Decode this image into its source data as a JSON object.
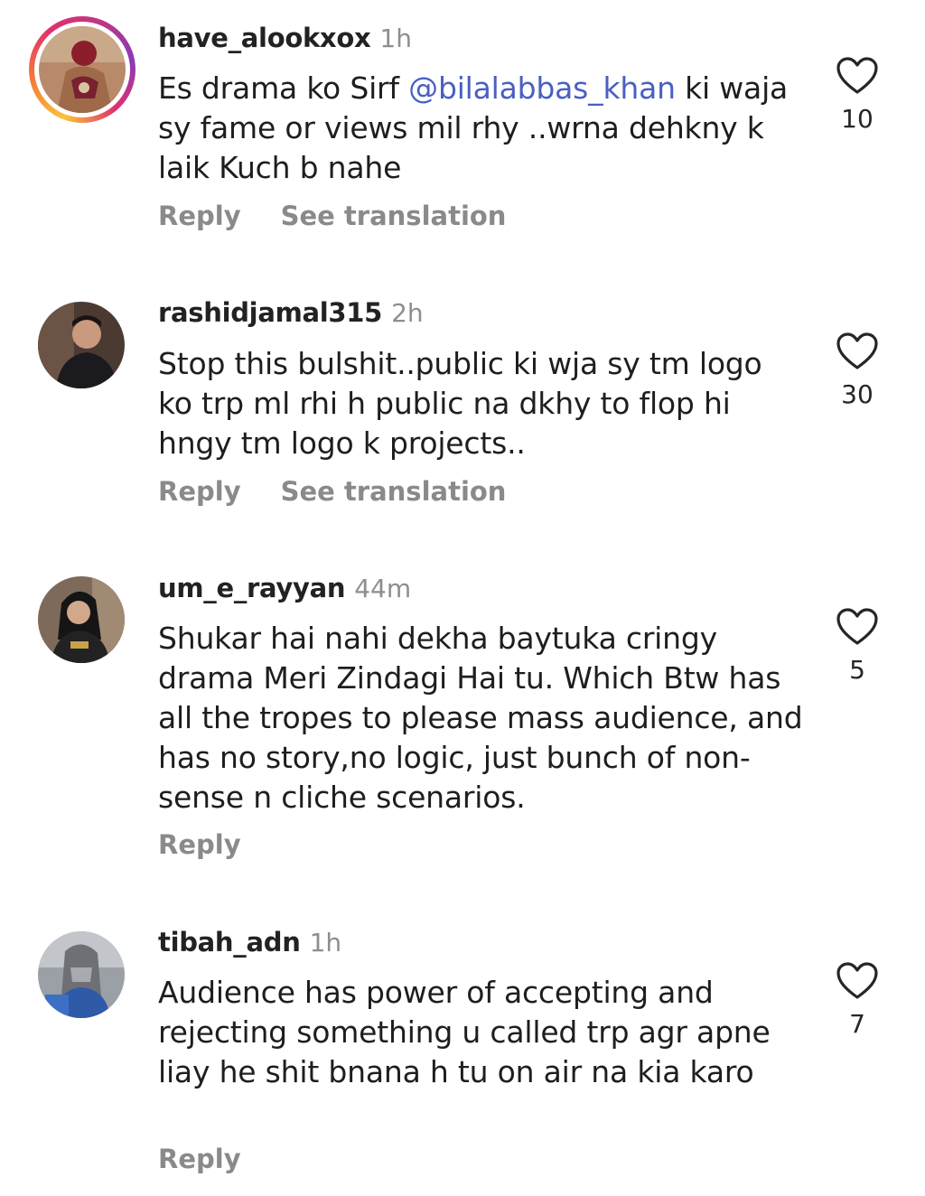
{
  "comments": [
    {
      "username": "have_alookxox",
      "time": "1h",
      "text_before": "Es drama ko Sirf ",
      "mention": "@bilalabbas_khan",
      "text_after": " ki waja sy fame or views mil rhy ..wrna dehkny k laik Kuch b nahe",
      "reply": "Reply",
      "translate": "See translation",
      "likes": "10"
    },
    {
      "username": "rashidjamal315",
      "time": "2h",
      "text": "Stop this bulshit..public ki wja sy tm logo ko trp ml rhi h public na dkhy to flop hi hngy tm logo k projects..",
      "reply": "Reply",
      "translate": "See translation",
      "likes": "30"
    },
    {
      "username": "um_e_rayyan",
      "time": "44m",
      "text": "Shukar hai nahi dekha baytuka cringy drama Meri Zindagi Hai tu. Which Btw has all the tropes to please mass audience, and has no story,no logic, just bunch of non-sense n cliche scenarios.",
      "reply": "Reply",
      "likes": "5"
    },
    {
      "username": "tibah_adn",
      "time": "1h",
      "text": "Audience has power of accepting and rejecting something u called trp agr apne liay he shit bnana h tu on air na kia karo",
      "reply": "Reply",
      "likes": "7"
    }
  ],
  "icons": {
    "like": "heart-outline-icon",
    "mention_prefix": "threads-at-icon"
  },
  "colors": {
    "mention": "#4a5fc1",
    "muted": "#8a8a8a",
    "story_ring": [
      "#f9c33a",
      "#e1306c",
      "#8a3ab9"
    ]
  }
}
